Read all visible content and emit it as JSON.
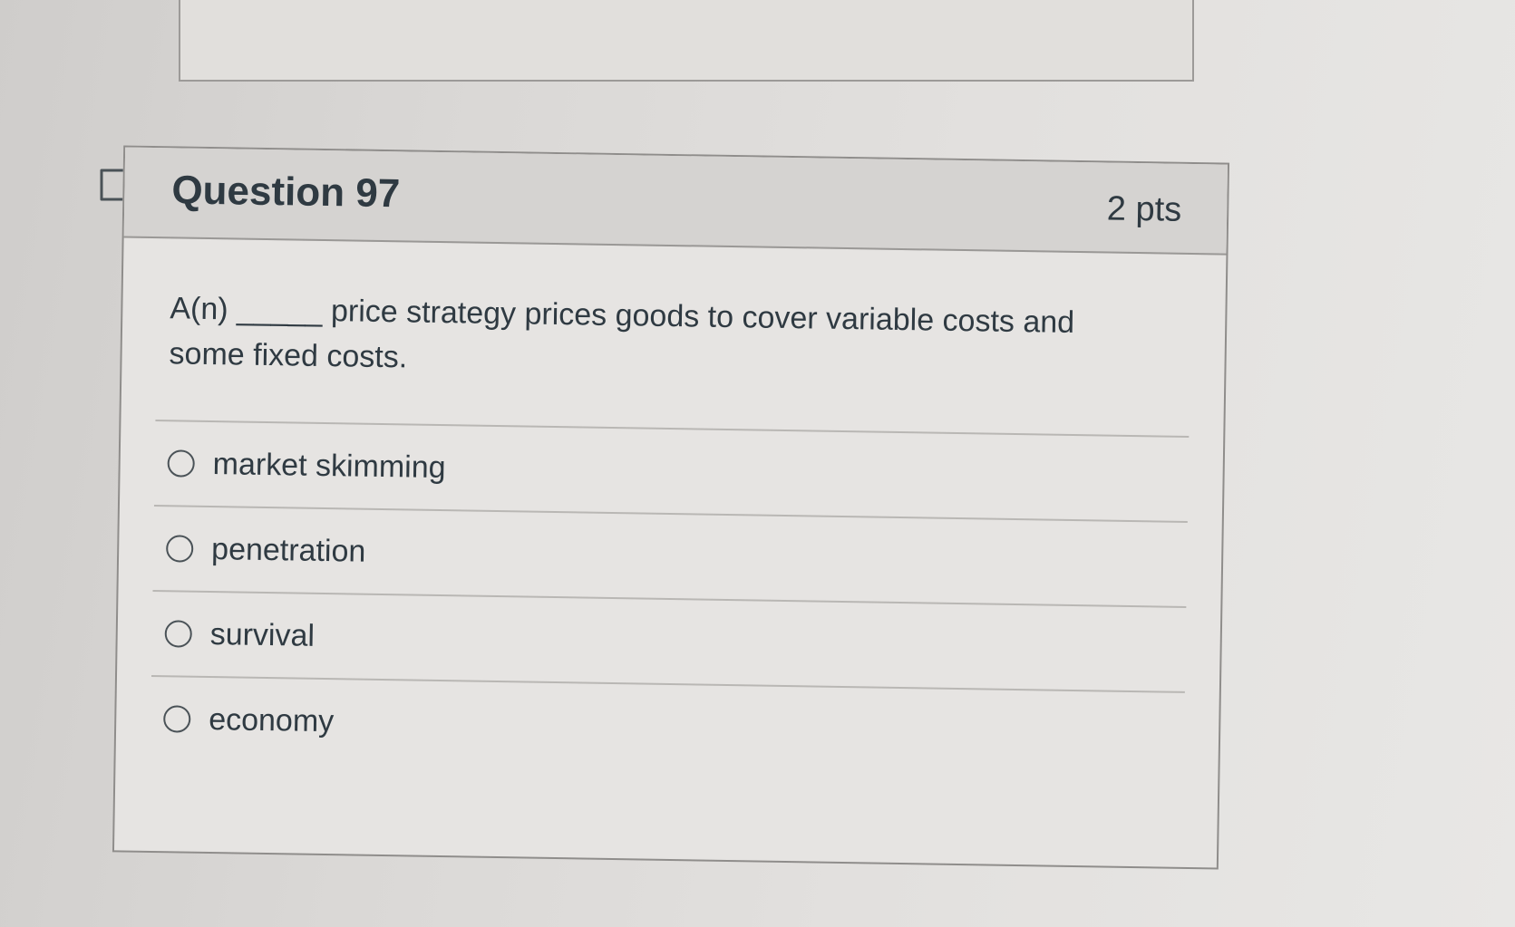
{
  "question": {
    "title": "Question 97",
    "points": "2 pts",
    "text": "A(n) _____ price strategy prices goods to cover variable costs and some fixed costs."
  },
  "answers": [
    {
      "label": "market skimming",
      "selected": false
    },
    {
      "label": "penetration",
      "selected": false
    },
    {
      "label": "survival",
      "selected": false
    },
    {
      "label": "economy",
      "selected": false
    }
  ],
  "icons": {
    "flag": "flag-question-icon",
    "radio": "radio-button-icon"
  },
  "colors": {
    "text": "#2f3a42",
    "header_bg": "#d5d3d1",
    "card_bg": "#e6e4e2",
    "border": "#8f8d8b"
  }
}
